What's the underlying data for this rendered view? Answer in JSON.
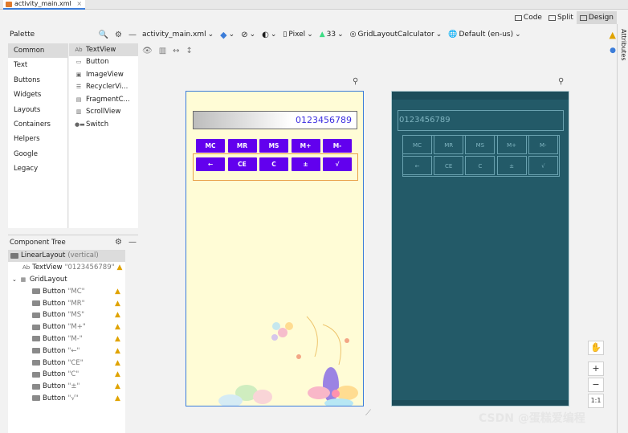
{
  "tab": {
    "filename": "activity_main.xml",
    "close": "×"
  },
  "modes": {
    "code": "Code",
    "split": "Split",
    "design": "Design"
  },
  "attributes_label": "Attributes",
  "palette": {
    "title": "Palette",
    "categories": [
      "Common",
      "Text",
      "Buttons",
      "Widgets",
      "Layouts",
      "Containers",
      "Helpers",
      "Google",
      "Legacy"
    ],
    "items": [
      {
        "icon": "Ab",
        "label": "TextView"
      },
      {
        "icon": "▭",
        "label": "Button"
      },
      {
        "icon": "▣",
        "label": "ImageView"
      },
      {
        "icon": "☰",
        "label": "RecyclerVi..."
      },
      {
        "icon": "▤",
        "label": "FragmentC..."
      },
      {
        "icon": "▥",
        "label": "ScrollView"
      },
      {
        "icon": "●▬",
        "label": "Switch"
      }
    ]
  },
  "component_tree": {
    "title": "Component Tree",
    "root": {
      "label": "LinearLayout",
      "extra": "(vertical)"
    },
    "textview": {
      "label": "TextView",
      "extra": "\"0123456789\""
    },
    "grid": {
      "label": "GridLayout"
    },
    "buttons": [
      {
        "label": "Button",
        "extra": "\"MC\""
      },
      {
        "label": "Button",
        "extra": "\"MR\""
      },
      {
        "label": "Button",
        "extra": "\"MS\""
      },
      {
        "label": "Button",
        "extra": "\"M+\""
      },
      {
        "label": "Button",
        "extra": "\"M-\""
      },
      {
        "label": "Button",
        "extra": "\"←\""
      },
      {
        "label": "Button",
        "extra": "\"CE\""
      },
      {
        "label": "Button",
        "extra": "\"C\""
      },
      {
        "label": "Button",
        "extra": "\"±\""
      },
      {
        "label": "Button",
        "extra": "\"√\""
      }
    ]
  },
  "toolbar": {
    "file": "activity_main.xml",
    "device": "Pixel",
    "api": "33",
    "theme": "GridLayoutCalculator",
    "locale": "Default (en-us)"
  },
  "preview": {
    "display_text": "0123456789",
    "row1": [
      "MC",
      "MR",
      "MS",
      "M+",
      "M-"
    ],
    "row2": [
      "←",
      "CE",
      "C",
      "±",
      "√"
    ]
  },
  "zoom": {
    "pan": "✋",
    "plus": "+",
    "minus": "−",
    "ratio": "1:1"
  },
  "watermark": "CSDN @蛋糕爱编程",
  "colors": {
    "accent": "#6200ee",
    "selection": "#3c7dd9",
    "blueprint": "#235a68",
    "warning": "#e0a300"
  }
}
